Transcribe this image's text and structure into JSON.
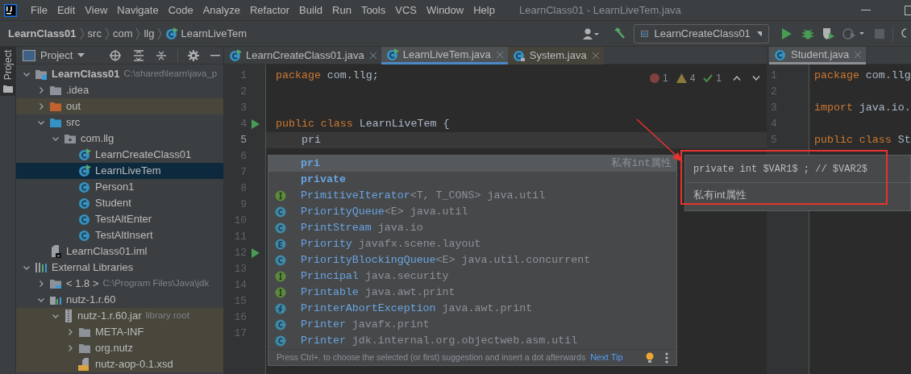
{
  "app_title": "LearnClass01 - LearnLiveTem.java",
  "menu": [
    "File",
    "Edit",
    "View",
    "Navigate",
    "Code",
    "Analyze",
    "Refactor",
    "Build",
    "Run",
    "Tools",
    "VCS",
    "Window",
    "Help"
  ],
  "breadcrumbs": [
    {
      "label": "LearnClass01",
      "kind": "project"
    },
    {
      "label": "src",
      "kind": "folder"
    },
    {
      "label": "com",
      "kind": "folder"
    },
    {
      "label": "llg",
      "kind": "folder"
    },
    {
      "label": "LearnLiveTem",
      "kind": "class"
    }
  ],
  "run_config": "LearnCreateClass01",
  "tool_window_tab": "Project",
  "project_panel": {
    "title": "Project",
    "tree": [
      {
        "label": "LearnClass01",
        "kind": "module",
        "hint": "C:\\shared\\learn\\java_p",
        "expanded": true,
        "selected": false,
        "children": [
          {
            "label": ".idea",
            "kind": "folder",
            "expanded": false,
            "selected": false
          },
          {
            "label": "out",
            "kind": "excluded_folder",
            "expanded": false,
            "selected": false
          },
          {
            "label": "src",
            "kind": "source_folder",
            "expanded": true,
            "selected": false,
            "children": [
              {
                "label": "com.llg",
                "kind": "package",
                "expanded": true,
                "selected": false,
                "children": [
                  {
                    "label": "LearnCreateClass01",
                    "kind": "runnable_class",
                    "selected": false
                  },
                  {
                    "label": "LearnLiveTem",
                    "kind": "runnable_class",
                    "selected": true
                  },
                  {
                    "label": "Person1",
                    "kind": "class",
                    "selected": false
                  },
                  {
                    "label": "Student",
                    "kind": "class",
                    "selected": false
                  },
                  {
                    "label": "TestAltEnter",
                    "kind": "class",
                    "selected": false
                  },
                  {
                    "label": "TestAltInsert",
                    "kind": "class",
                    "selected": false
                  }
                ]
              }
            ]
          },
          {
            "label": "LearnClass01.iml",
            "kind": "iml",
            "selected": false
          }
        ]
      },
      {
        "label": "External Libraries",
        "kind": "libraries",
        "expanded": true,
        "selected": false,
        "children": [
          {
            "label": "< 1.8 >",
            "kind": "jdk",
            "hint": "C:\\Program Files\\Java\\jdk",
            "expanded": false,
            "selected": false
          },
          {
            "label": "nutz-1.r.60",
            "kind": "library",
            "expanded": true,
            "selected": false,
            "children": [
              {
                "label": "nutz-1.r.60.jar",
                "kind": "jar",
                "hint": "library root",
                "expanded": true,
                "selected": false,
                "children": [
                  {
                    "label": "META-INF",
                    "kind": "folder",
                    "expanded": false,
                    "selected": false
                  },
                  {
                    "label": "org.nutz",
                    "kind": "folder",
                    "expanded": false,
                    "selected": false
                  },
                  {
                    "label": "nutz-aop-0.1.xsd",
                    "kind": "xsd",
                    "selected": false
                  }
                ]
              }
            ]
          }
        ]
      }
    ]
  },
  "editor": {
    "tabs": [
      {
        "label": "LearnCreateClass01.java",
        "kind": "runnable_class",
        "selected": false
      },
      {
        "label": "LearnLiveTem.java",
        "kind": "runnable_class",
        "selected": true
      },
      {
        "label": "System.java",
        "kind": "library_class",
        "selected": false
      }
    ],
    "inspections": {
      "errors": "1",
      "warnings": "4",
      "weak_warnings": "1"
    },
    "lines": [
      {
        "number": "1",
        "run": false,
        "tokens": [
          {
            "kind": "keyword",
            "text": "package"
          },
          {
            "kind": "plain",
            "text": " com.llg;"
          }
        ]
      },
      {
        "number": "2",
        "run": false
      },
      {
        "number": "3",
        "run": false
      },
      {
        "number": "4",
        "run": true,
        "tokens": [
          {
            "kind": "keyword",
            "text": "public class"
          },
          {
            "kind": "plain",
            "text": " LearnLiveTem {"
          }
        ]
      },
      {
        "number": "5",
        "run": false,
        "current": true,
        "tokens": [
          {
            "kind": "plain",
            "text": "    pri"
          }
        ]
      },
      {
        "number": "6",
        "run": false
      },
      {
        "number": "7",
        "run": false
      },
      {
        "number": "8",
        "run": false
      },
      {
        "number": "9",
        "run": false
      },
      {
        "number": "10",
        "run": false
      },
      {
        "number": "11",
        "run": false
      },
      {
        "number": "12",
        "run": true
      },
      {
        "number": "13",
        "run": false
      },
      {
        "number": "14",
        "run": false
      },
      {
        "number": "15",
        "run": false
      },
      {
        "number": "16",
        "run": false
      },
      {
        "number": "17",
        "run": false
      }
    ]
  },
  "completion": {
    "items": [
      {
        "kind": "template",
        "name": "pri",
        "type_text": "私有int属性",
        "selected": true
      },
      {
        "kind": "keyword",
        "name": "private",
        "selected": false
      },
      {
        "kind": "interface",
        "name": "PrimitiveIterator",
        "generic": "<T, T_CONS>",
        "tail": "java.util",
        "selected": false
      },
      {
        "kind": "class",
        "name": "PriorityQueue",
        "generic": "<E>",
        "tail": "java.util",
        "selected": false
      },
      {
        "kind": "class",
        "name": "PrintStream",
        "tail": "java.io",
        "selected": false
      },
      {
        "kind": "enum",
        "name": "Priority",
        "tail": "javafx.scene.layout",
        "selected": false
      },
      {
        "kind": "class",
        "name": "PriorityBlockingQueue",
        "generic": "<E>",
        "tail": "java.util.concurrent",
        "selected": false
      },
      {
        "kind": "interface",
        "name": "Principal",
        "tail": "java.security",
        "selected": false
      },
      {
        "kind": "interface",
        "name": "Printable",
        "tail": "java.awt.print",
        "selected": false
      },
      {
        "kind": "exception",
        "name": "PrinterAbortException",
        "tail": "java.awt.print",
        "selected": false
      },
      {
        "kind": "class",
        "name": "Printer",
        "tail": "javafx.print",
        "selected": false
      },
      {
        "kind": "class",
        "name": "Printer",
        "tail": "jdk.internal.org.objectweb.asm.util",
        "selected": false
      }
    ],
    "hint": "Press Ctrl+. to choose the selected (or first) suggestion and insert a dot afterwards",
    "next_tip": "Next Tip"
  },
  "template_doc": {
    "code": "private int $VAR1$ ; // $VAR2$",
    "description": "私有int属性"
  },
  "side_editor": {
    "tab": "Student.java",
    "lines": [
      {
        "number": "1",
        "tokens": [
          {
            "kind": "keyword",
            "text": "package"
          },
          {
            "kind": "plain",
            "text": " com.llg"
          }
        ]
      },
      {
        "number": "2"
      },
      {
        "number": "3",
        "tokens": [
          {
            "kind": "keyword",
            "text": "import"
          },
          {
            "kind": "plain",
            "text": " java.io."
          }
        ]
      },
      {
        "number": "4"
      },
      {
        "number": "5",
        "tokens": [
          {
            "kind": "keyword",
            "text": "public class"
          },
          {
            "kind": "plain",
            "text": " St"
          }
        ]
      }
    ]
  }
}
